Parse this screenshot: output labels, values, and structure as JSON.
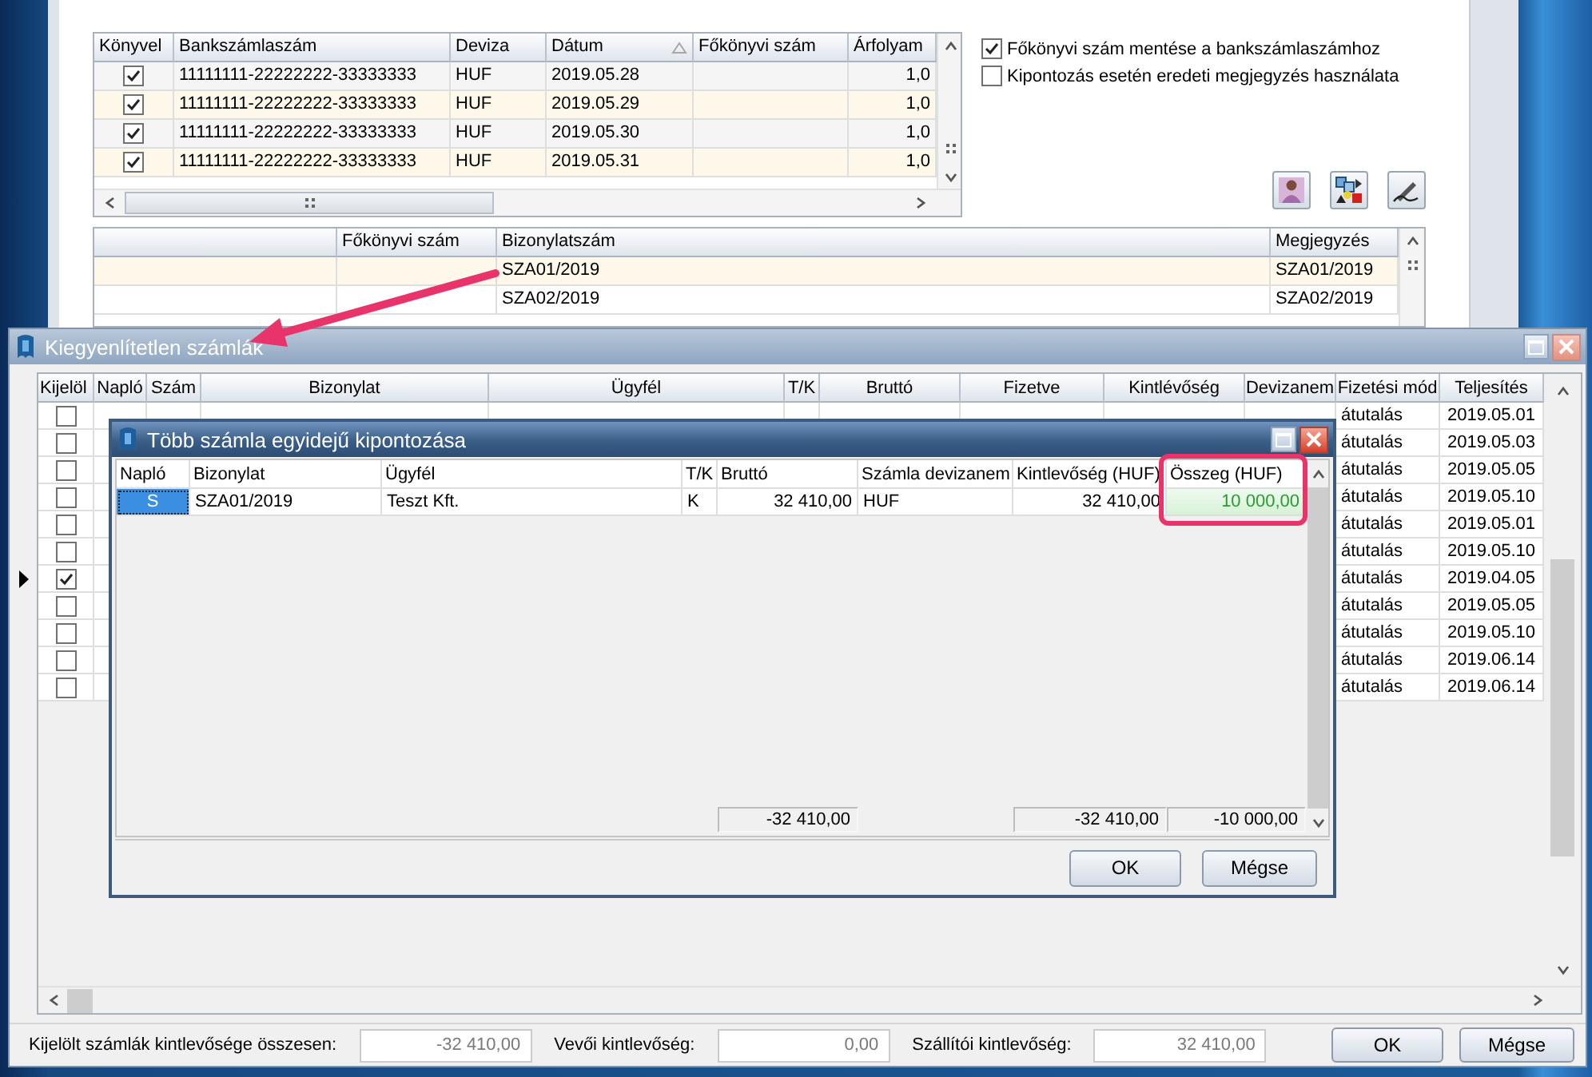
{
  "back_window": {
    "bank_grid": {
      "columns": [
        {
          "label": "Könyvel",
          "sorted": false
        },
        {
          "label": "Bankszámlaszám",
          "sorted": false
        },
        {
          "label": "Deviza",
          "sorted": false
        },
        {
          "label": "Dátum",
          "sorted": true
        },
        {
          "label": "Főkönyvi szám",
          "sorted": false
        },
        {
          "label": "Árfolyam",
          "sorted": false
        }
      ],
      "rows": [
        {
          "book": true,
          "account": "11111111-22222222-33333333",
          "currency": "HUF",
          "date": "2019.05.28",
          "rate": "1,0"
        },
        {
          "book": true,
          "account": "11111111-22222222-33333333",
          "currency": "HUF",
          "date": "2019.05.29",
          "rate": "1,0"
        },
        {
          "book": true,
          "account": "11111111-22222222-33333333",
          "currency": "HUF",
          "date": "2019.05.30",
          "rate": "1,0"
        },
        {
          "book": true,
          "account": "11111111-22222222-33333333",
          "currency": "HUF",
          "date": "2019.05.31",
          "rate": "1,0"
        }
      ]
    },
    "options": [
      {
        "label": "Főkönyvi szám mentése a bankszámlaszámhoz",
        "checked": true
      },
      {
        "label": "Kipontozás esetén eredeti megjegyzés használata",
        "checked": false
      }
    ],
    "doc_grid": {
      "columns": [
        "Főkönyvi szám",
        "Bizonylatszám",
        "Megjegyzés"
      ],
      "rows": [
        {
          "document": "SZA01/2019",
          "note": "SZA01/2019"
        },
        {
          "document": "SZA02/2019",
          "note": "SZA02/2019"
        }
      ]
    }
  },
  "invoices_window": {
    "title": "Kiegyenlítetlen számlák",
    "active": false,
    "columns": [
      "Kijelöl",
      "Napló",
      "Szám",
      "Bizonylat",
      "Ügyfél",
      "T/K",
      "Bruttó",
      "Fizetve",
      "Kintlévőség",
      "Devizanem",
      "Fizetési mód",
      "Teljesítés"
    ],
    "rows": [
      {
        "checked": false,
        "current": false,
        "payment_method": "átutalás",
        "completion": "2019.05.01"
      },
      {
        "checked": false,
        "current": false,
        "payment_method": "átutalás",
        "completion": "2019.05.03"
      },
      {
        "checked": false,
        "current": false,
        "payment_method": "átutalás",
        "completion": "2019.05.05"
      },
      {
        "checked": false,
        "current": false,
        "payment_method": "átutalás",
        "completion": "2019.05.10"
      },
      {
        "checked": false,
        "current": false,
        "payment_method": "átutalás",
        "completion": "2019.05.01"
      },
      {
        "checked": false,
        "current": false,
        "payment_method": "átutalás",
        "completion": "2019.05.10"
      },
      {
        "checked": true,
        "current": true,
        "payment_method": "átutalás",
        "completion": "2019.04.05"
      },
      {
        "checked": false,
        "current": false,
        "payment_method": "átutalás",
        "completion": "2019.05.05"
      },
      {
        "checked": false,
        "current": false,
        "payment_method": "átutalás",
        "completion": "2019.05.10"
      },
      {
        "checked": false,
        "current": false,
        "payment_method": "átutalás",
        "completion": "2019.06.14"
      },
      {
        "checked": false,
        "current": false,
        "payment_method": "átutalás",
        "completion": "2019.06.14"
      }
    ],
    "summary": [
      {
        "label": "Kijelölt számlák kintlevősége összesen:",
        "value": "-32 410,00"
      },
      {
        "label": "Vevői kintlevőség:",
        "value": "0,00"
      },
      {
        "label": "Szállítói kintlevőség:",
        "value": "32 410,00"
      }
    ],
    "buttons": [
      "OK",
      "Mégse"
    ]
  },
  "dialog": {
    "title": "Több számla egyidejű kipontozása",
    "active": true,
    "columns": [
      "Napló",
      "Bizonylat",
      "Ügyfél",
      "T/K",
      "Bruttó",
      "Számla devizanem",
      "Kintlevőség (HUF)",
      "Összeg (HUF)"
    ],
    "rows": [
      {
        "cells": [
          {
            "text": "S",
            "selected": true,
            "edited": false
          },
          {
            "text": "SZA01/2019",
            "selected": false,
            "edited": false
          },
          {
            "text": "Teszt Kft.",
            "selected": false,
            "edited": false
          },
          {
            "text": "K",
            "selected": false,
            "edited": false
          },
          {
            "text": "32 410,00",
            "selected": false,
            "edited": false
          },
          {
            "text": "HUF",
            "selected": false,
            "edited": false
          },
          {
            "text": "32 410,00",
            "selected": false,
            "edited": false
          },
          {
            "text": "10 000,00",
            "selected": false,
            "edited": true
          }
        ]
      }
    ],
    "totals": {
      "gross": "-32 410,00",
      "receivable": "-32 410,00",
      "amount": "-10 000,00"
    },
    "buttons": [
      "OK",
      "Mégse"
    ]
  }
}
